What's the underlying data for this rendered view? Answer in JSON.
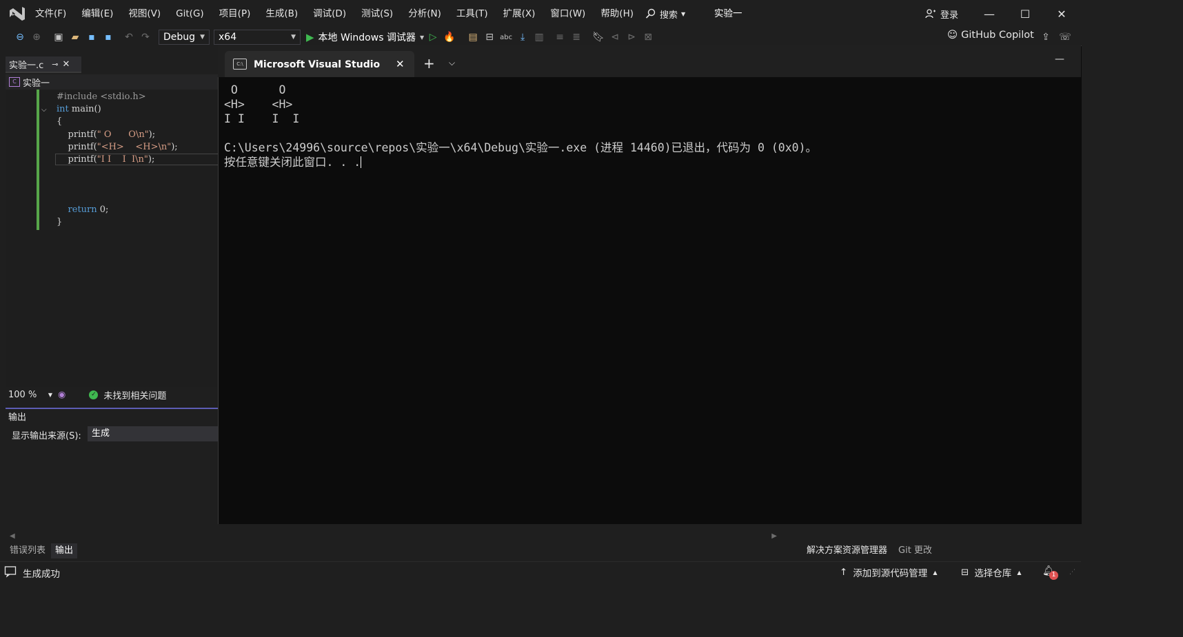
{
  "menu": {
    "items": [
      "文件(F)",
      "编辑(E)",
      "视图(V)",
      "Git(G)",
      "项目(P)",
      "生成(B)",
      "调试(D)",
      "测试(S)",
      "分析(N)",
      "工具(T)",
      "扩展(X)",
      "窗口(W)",
      "帮助(H)"
    ],
    "search_label": "搜索",
    "solution_name": "实验一",
    "login_label": "登录"
  },
  "toolbar": {
    "config": "Debug",
    "platform": "x64",
    "debugger_label": "本地 Windows 调试器",
    "copilot_label": "GitHub Copilot"
  },
  "editor": {
    "tab_label": "实验一.c",
    "nav_label": "实验一",
    "code": {
      "l1": "#include <stdio.h>",
      "l2_kw": "int",
      "l2_rest": " main()",
      "l3": "{",
      "l4_fn": "printf(",
      "l4_str": "\" O      O\\n\"",
      "l4_end": ");",
      "l5_fn": "printf(",
      "l5_str": "\"<H>    <H>\\n\"",
      "l5_end": ");",
      "l6_fn": "printf(",
      "l6_str": "\"I I    I  I\\n\"",
      "l6_end": ");",
      "l10_kw": "return",
      "l10_rest": " 0;",
      "l11": "}"
    },
    "zoom": "100 %",
    "issues": "未找到相关问题"
  },
  "output": {
    "title": "输出",
    "source_label": "显示输出来源(S):",
    "source_value": "生成"
  },
  "bottom_tabs": [
    "错误列表",
    "输出"
  ],
  "right_tabs": [
    "解决方案资源管理器",
    "Git 更改"
  ],
  "console": {
    "tab_title": "Microsoft Visual Studio 调试控制台",
    "lines": [
      " O      O",
      "<H>    <H>",
      "I I    I  I",
      "",
      "C:\\Users\\24996\\source\\repos\\实验一\\x64\\Debug\\实验一.exe (进程 14460)已退出，代码为 0 (0x0)。",
      "按任意键关闭此窗口. . ."
    ]
  },
  "status": {
    "left": "生成成功",
    "source_control": "添加到源代码管理",
    "repo": "选择仓库",
    "notif_count": "1"
  },
  "colors": {
    "background": "#1f1f1f",
    "console_bg": "#0c0c0c",
    "accent": "#5d5db5",
    "keyword": "#569cd6",
    "string": "#d69d85",
    "success": "#3fb950"
  }
}
